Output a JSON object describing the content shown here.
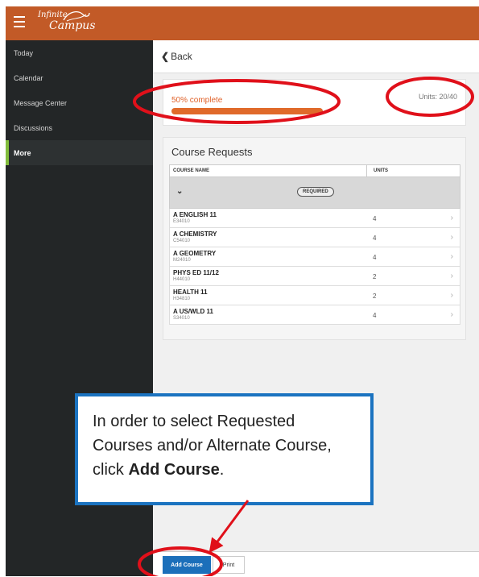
{
  "header": {
    "logo_top": "Infinite",
    "logo_bottom": "Campus"
  },
  "sidebar": {
    "items": [
      {
        "label": "Today"
      },
      {
        "label": "Calendar"
      },
      {
        "label": "Message Center"
      },
      {
        "label": "Discussions"
      },
      {
        "label": "More"
      }
    ],
    "active": "More"
  },
  "back_label": "Back",
  "progress": {
    "percent_label": "50% complete",
    "value": 0.5,
    "units_label": "Units: 20/40"
  },
  "course_requests": {
    "title": "Course Requests",
    "columns": [
      "COURSE NAME",
      "UNITS"
    ],
    "group_label": "REQUIRED",
    "rows": [
      {
        "name": "A ENGLISH 11",
        "code": "E34010",
        "units": "4"
      },
      {
        "name": "A CHEMISTRY",
        "code": "C54010",
        "units": "4"
      },
      {
        "name": "A GEOMETRY",
        "code": "M24010",
        "units": "4"
      },
      {
        "name": "PHYS ED 11/12",
        "code": "H44010",
        "units": "2"
      },
      {
        "name": "HEALTH 11",
        "code": "H34810",
        "units": "2"
      },
      {
        "name": "A US/WLD 11",
        "code": "S34010",
        "units": "4"
      }
    ]
  },
  "callout": {
    "text_before": "In order to select Requested Courses and/or Alternate Course, click ",
    "text_bold": "Add Course",
    "text_after": "."
  },
  "footer": {
    "add_label": "Add Course",
    "print_label": "Print"
  },
  "colors": {
    "header": "#c25a27",
    "sidebar": "#232627",
    "accent_progress": "#e06a2a",
    "active_marker": "#82bd3c",
    "button": "#1b6fba",
    "annotation": "#e0101a",
    "callout_border": "#1b73c0"
  }
}
